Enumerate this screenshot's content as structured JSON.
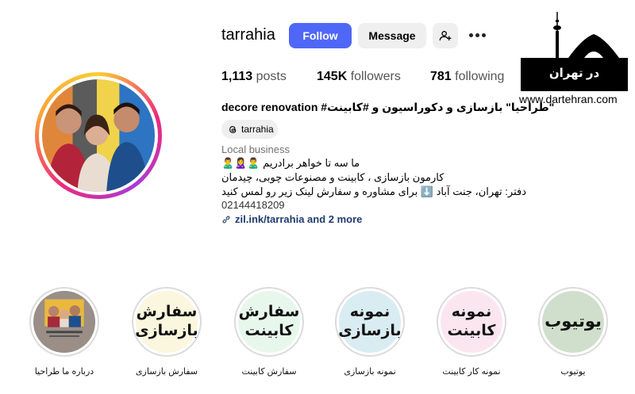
{
  "profile": {
    "username": "tarrahia",
    "follow_label": "Follow",
    "message_label": "Message",
    "posts_count": "1,113",
    "posts_label": "posts",
    "followers_count": "145K",
    "followers_label": "followers",
    "following_count": "781",
    "following_label": "following"
  },
  "bio": {
    "title": "decore renovation #طراحیا\" بازسازی و دکوراسیون و #کابینت\"",
    "threads_handle": "tarrahia",
    "category": "Local business",
    "lines": [
      "🙎‍♂️🙎‍♀️🙎‍♂️ ما سه تا خواهر برادریم",
      "کارمون بازسازی ، کابینت و مصنوعات چوبی، چیدمان",
      "دفتر: تهران، جنت آباد ⬇️ برای مشاوره و سفارش لینک زیر رو لمس کنید"
    ],
    "phone": "02144418209",
    "link": "zil.ink/tarrahia and 2 more"
  },
  "logo": {
    "text": "در تهران",
    "url": "www.dartehran.com"
  },
  "highlights": [
    {
      "title_lines": [],
      "label": "درباره ما طراحیا",
      "bg": "#8a8a8a"
    },
    {
      "title_lines": [
        "سفارش",
        "بازسازی"
      ],
      "label": "سفارش بازسازی",
      "bg": "#fbf6de"
    },
    {
      "title_lines": [
        "سفارش",
        "کابینت"
      ],
      "label": "سفارش کابینت",
      "bg": "#e8f7ec"
    },
    {
      "title_lines": [
        "نمونه",
        "بازسازی"
      ],
      "label": "نمونه بازسازی",
      "bg": "#d9ecf1"
    },
    {
      "title_lines": [
        "نمونه",
        "کابینت"
      ],
      "label": "نمونه کار کابینت",
      "bg": "#fbe6f0"
    },
    {
      "title_lines": [
        "یوتیوب"
      ],
      "label": "یوتیوب",
      "bg": "#cfdfcc"
    }
  ],
  "colors": {
    "follow": "#4f67f7",
    "secondary_button": "#efefef",
    "link": "#1f3a6e"
  },
  "icons": [
    "add-user-icon",
    "more-icon",
    "threads-icon",
    "link-icon"
  ]
}
